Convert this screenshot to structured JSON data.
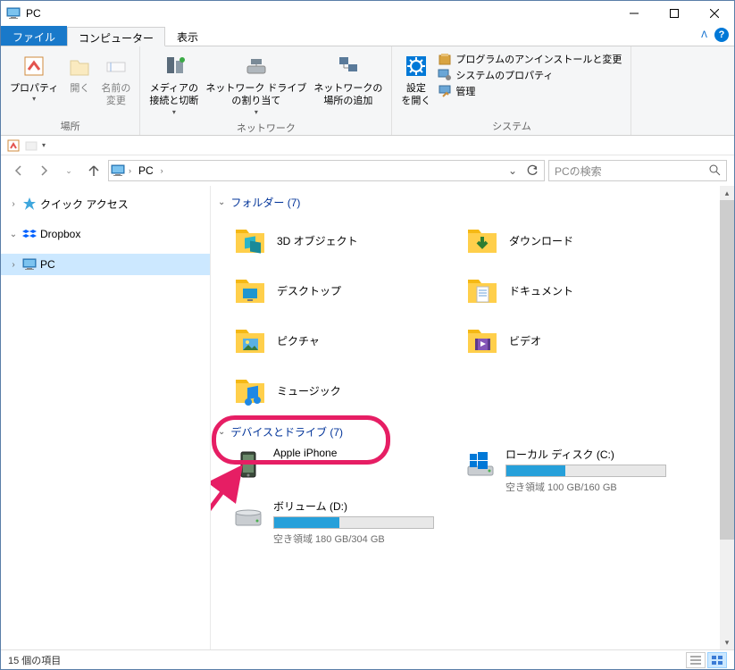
{
  "window": {
    "title": "PC"
  },
  "tabs": {
    "file": "ファイル",
    "computer": "コンピューター",
    "view": "表示"
  },
  "ribbon": {
    "group_place": {
      "label": "場所",
      "properties": "プロパティ",
      "open": "開く",
      "rename": "名前の\n変更"
    },
    "group_network": {
      "label": "ネットワーク",
      "media": "メディアの\n接続と切断",
      "map_drive": "ネットワーク ドライブ\nの割り当て",
      "add_location": "ネットワークの\n場所の追加"
    },
    "group_system": {
      "label": "システム",
      "settings": "設定\nを開く",
      "uninstall": "プログラムのアンインストールと変更",
      "sys_props": "システムのプロパティ",
      "manage": "管理"
    }
  },
  "nav": {
    "crumb": "PC",
    "search_placeholder": "PCの検索"
  },
  "sidebar": {
    "quick_access": "クイック アクセス",
    "dropbox": "Dropbox",
    "pc": "PC"
  },
  "content": {
    "folders_header": "フォルダー (7)",
    "folders": [
      {
        "name": "3D オブジェクト",
        "icon": "3d"
      },
      {
        "name": "ダウンロード",
        "icon": "download"
      },
      {
        "name": "デスクトップ",
        "icon": "desktop"
      },
      {
        "name": "ドキュメント",
        "icon": "document"
      },
      {
        "name": "ピクチャ",
        "icon": "picture"
      },
      {
        "name": "ビデオ",
        "icon": "video"
      },
      {
        "name": "ミュージック",
        "icon": "music"
      }
    ],
    "drives_header": "デバイスとドライブ (7)",
    "drives": [
      {
        "name": "Apple iPhone",
        "icon": "iphone",
        "bar": null,
        "sub": null
      },
      {
        "name": "ローカル ディスク (C:)",
        "icon": "win-drive",
        "bar_pct": 37,
        "sub": "空き領域 100 GB/160 GB"
      },
      {
        "name": "ボリューム (D:)",
        "icon": "drive",
        "bar_pct": 41,
        "sub": "空き領域 180 GB/304 GB"
      }
    ]
  },
  "status": {
    "text": "15 個の項目"
  }
}
